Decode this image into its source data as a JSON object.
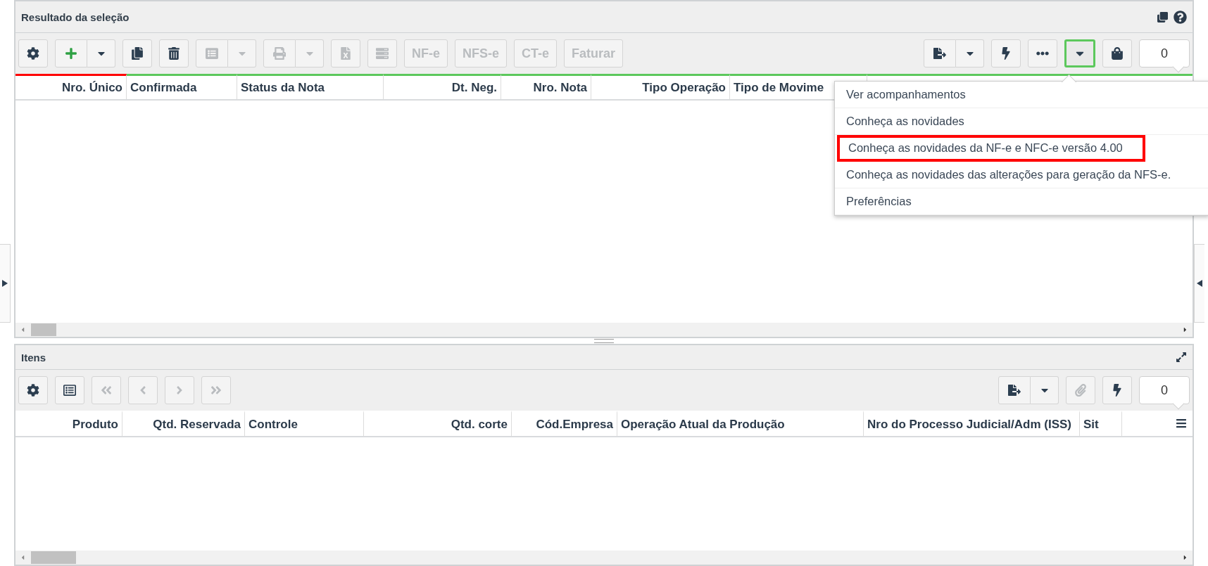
{
  "top_panel": {
    "title": "Resultado da seleção",
    "toolbar_left": [
      {
        "kind": "icon",
        "disabled": false
      },
      {
        "kind": "split",
        "disabled": false
      },
      {
        "kind": "icon",
        "disabled": false
      },
      {
        "kind": "icon",
        "disabled": false
      },
      {
        "kind": "split",
        "disabled": true
      },
      {
        "kind": "split",
        "disabled": true
      },
      {
        "kind": "icon",
        "disabled": true
      },
      {
        "kind": "icon",
        "disabled": true
      },
      {
        "kind": "text",
        "label": "NF-e",
        "disabled": true
      },
      {
        "kind": "text",
        "label": "NFS-e",
        "disabled": true
      },
      {
        "kind": "text",
        "label": "CT-e",
        "disabled": true
      },
      {
        "kind": "text",
        "label": "Faturar",
        "disabled": true
      }
    ],
    "toolbar_right": [
      {
        "kind": "split",
        "selected": false
      },
      {
        "kind": "icon",
        "selected": false
      },
      {
        "kind": "icon",
        "selected": false
      },
      {
        "kind": "caret",
        "selected": true
      },
      {
        "kind": "icon",
        "selected": false
      }
    ],
    "counter": "0",
    "columns": [
      {
        "label": "Nro. Único",
        "color": "#ff0000"
      },
      {
        "label": "Confirmada",
        "color": "#5cc85c"
      },
      {
        "label": "Status da Nota",
        "color": "#5cc85c"
      },
      {
        "label": "Dt. Neg.",
        "color": "#5cc85c"
      },
      {
        "label": "Nro. Nota",
        "color": "#5cc85c"
      },
      {
        "label": "Tipo Operação",
        "color": "#5cc85c"
      },
      {
        "label": "Tipo de Movime",
        "color": "#5cc85c"
      }
    ],
    "menu": [
      {
        "label": "Ver acompanhamentos",
        "highlighted": false
      },
      {
        "label": "Conheça as novidades",
        "highlighted": false
      },
      {
        "label": "Conheça as novidades da NF-e e NFC-e versão 4.00",
        "highlighted": true
      },
      {
        "label": "Conheça as novidades das alterações para geração da NFS-e.",
        "highlighted": false
      },
      {
        "label": "Preferências",
        "highlighted": false
      }
    ]
  },
  "bottom_panel": {
    "title": "Itens",
    "toolbar_left": [
      {
        "kind": "icon",
        "disabled": false
      },
      {
        "kind": "icon",
        "disabled": false
      },
      {
        "kind": "icon",
        "disabled": true
      },
      {
        "kind": "icon",
        "disabled": true
      },
      {
        "kind": "icon",
        "disabled": true
      },
      {
        "kind": "icon",
        "disabled": true
      }
    ],
    "toolbar_right": [
      {
        "kind": "split",
        "disabled": false
      },
      {
        "kind": "icon",
        "disabled": true
      },
      {
        "kind": "icon",
        "disabled": false
      }
    ],
    "counter": "0",
    "columns": [
      {
        "label": "Produto"
      },
      {
        "label": "Qtd. Reservada"
      },
      {
        "label": "Controle"
      },
      {
        "label": "Qtd. corte"
      },
      {
        "label": "Cód.Empresa"
      },
      {
        "label": "Operação Atual da Produção"
      },
      {
        "label": "Nro do Processo Judicial/Adm (ISS)"
      },
      {
        "label": "Sit"
      }
    ]
  }
}
